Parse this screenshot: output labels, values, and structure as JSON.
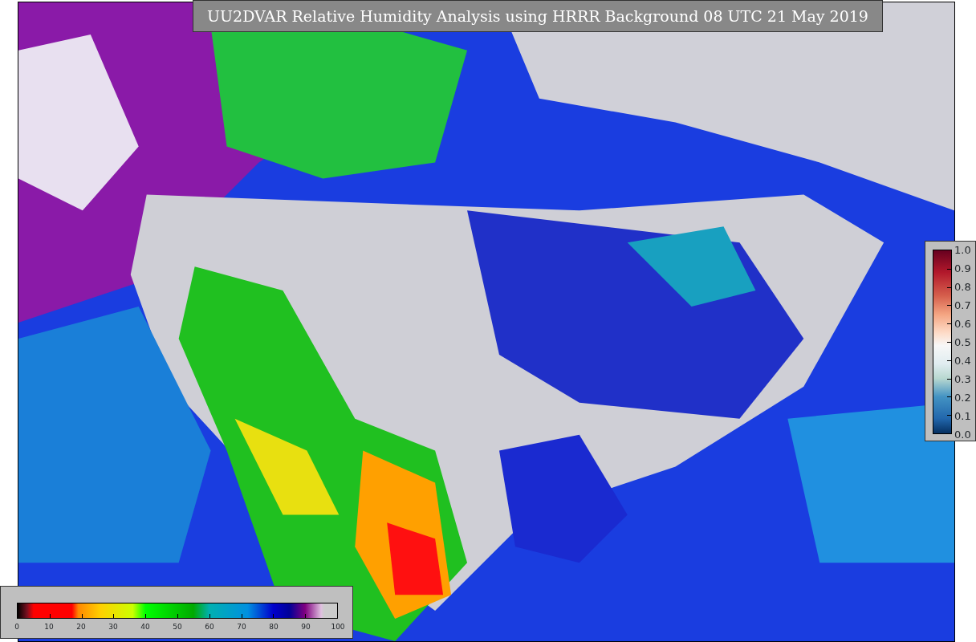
{
  "map": {
    "title": "UU2DVAR Relative Humidity Analysis using HRRR Background 08 UTC 21 May 2019"
  },
  "humidity_colorbar": {
    "ticks": [
      "0",
      "10",
      "20",
      "30",
      "40",
      "50",
      "60",
      "70",
      "80",
      "90",
      "100"
    ]
  },
  "observation_colorbar": {
    "ticks": [
      "1.0",
      "0.9",
      "0.8",
      "0.7",
      "0.6",
      "0.5",
      "0.4",
      "0.3",
      "0.2",
      "0.1",
      "0.0"
    ]
  }
}
